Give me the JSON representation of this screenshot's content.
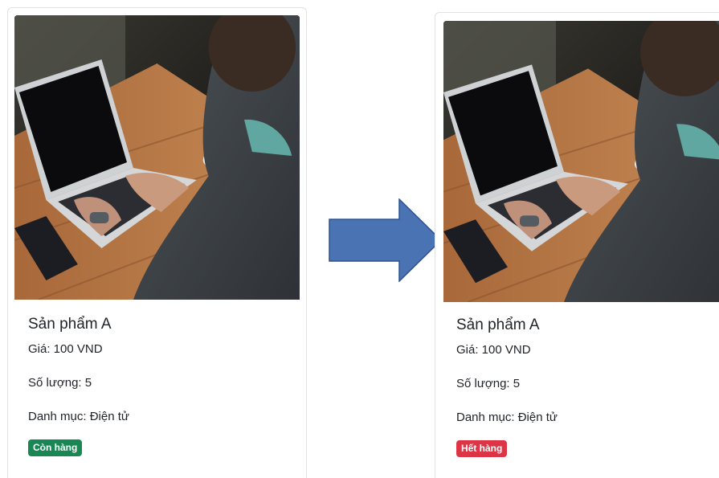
{
  "cards": [
    {
      "title": "Sản phẩm A",
      "price": "Giá: 100 VND",
      "quantity": "Số lượng: 5",
      "category": "Danh mục: Điện tử",
      "status": "Còn hàng",
      "status_color": "#198754"
    },
    {
      "title": "Sản phẩm A",
      "price": "Giá: 100 VND",
      "quantity": "Số lượng: 5",
      "category": "Danh mục: Điện tử",
      "status": "Hết hàng",
      "status_color": "#dc3545"
    }
  ],
  "arrow": {
    "fill": "#4a73b4",
    "stroke": "#2f528f",
    "icon": "right-arrow-icon"
  }
}
